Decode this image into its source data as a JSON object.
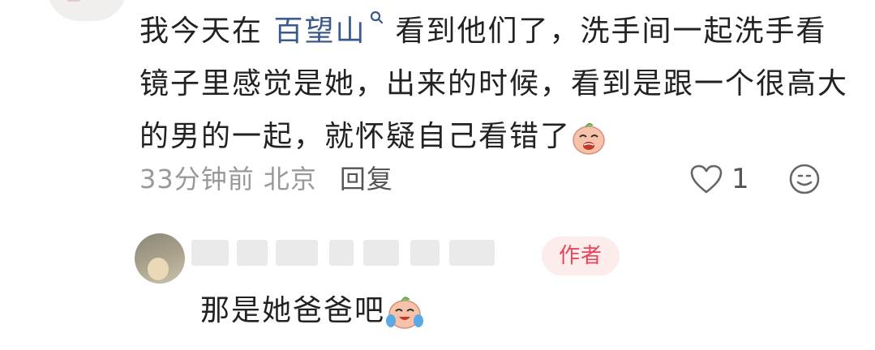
{
  "comment": {
    "text_before_link": "我今天在 ",
    "link_text": "百望山",
    "text_after_link": "看到他们了，洗手间一起洗手看镜子里感觉是她，出来的时候，看到是跟一个很高大的男的一起，就怀疑自己看错了",
    "time_location": "33分钟前 北京",
    "reply_label": "回复",
    "like_count": "1",
    "link_color": "#3a5a8c"
  },
  "reply": {
    "author_badge": "作者",
    "text": "那是她爸爸吧",
    "badge_color": "#e8455a"
  },
  "icons": {
    "search": "search-icon",
    "emoji_crying": "crying-face-icon",
    "emoji_tears_of_joy": "laughing-tears-icon",
    "heart": "heart-icon",
    "smile": "smile-icon"
  }
}
